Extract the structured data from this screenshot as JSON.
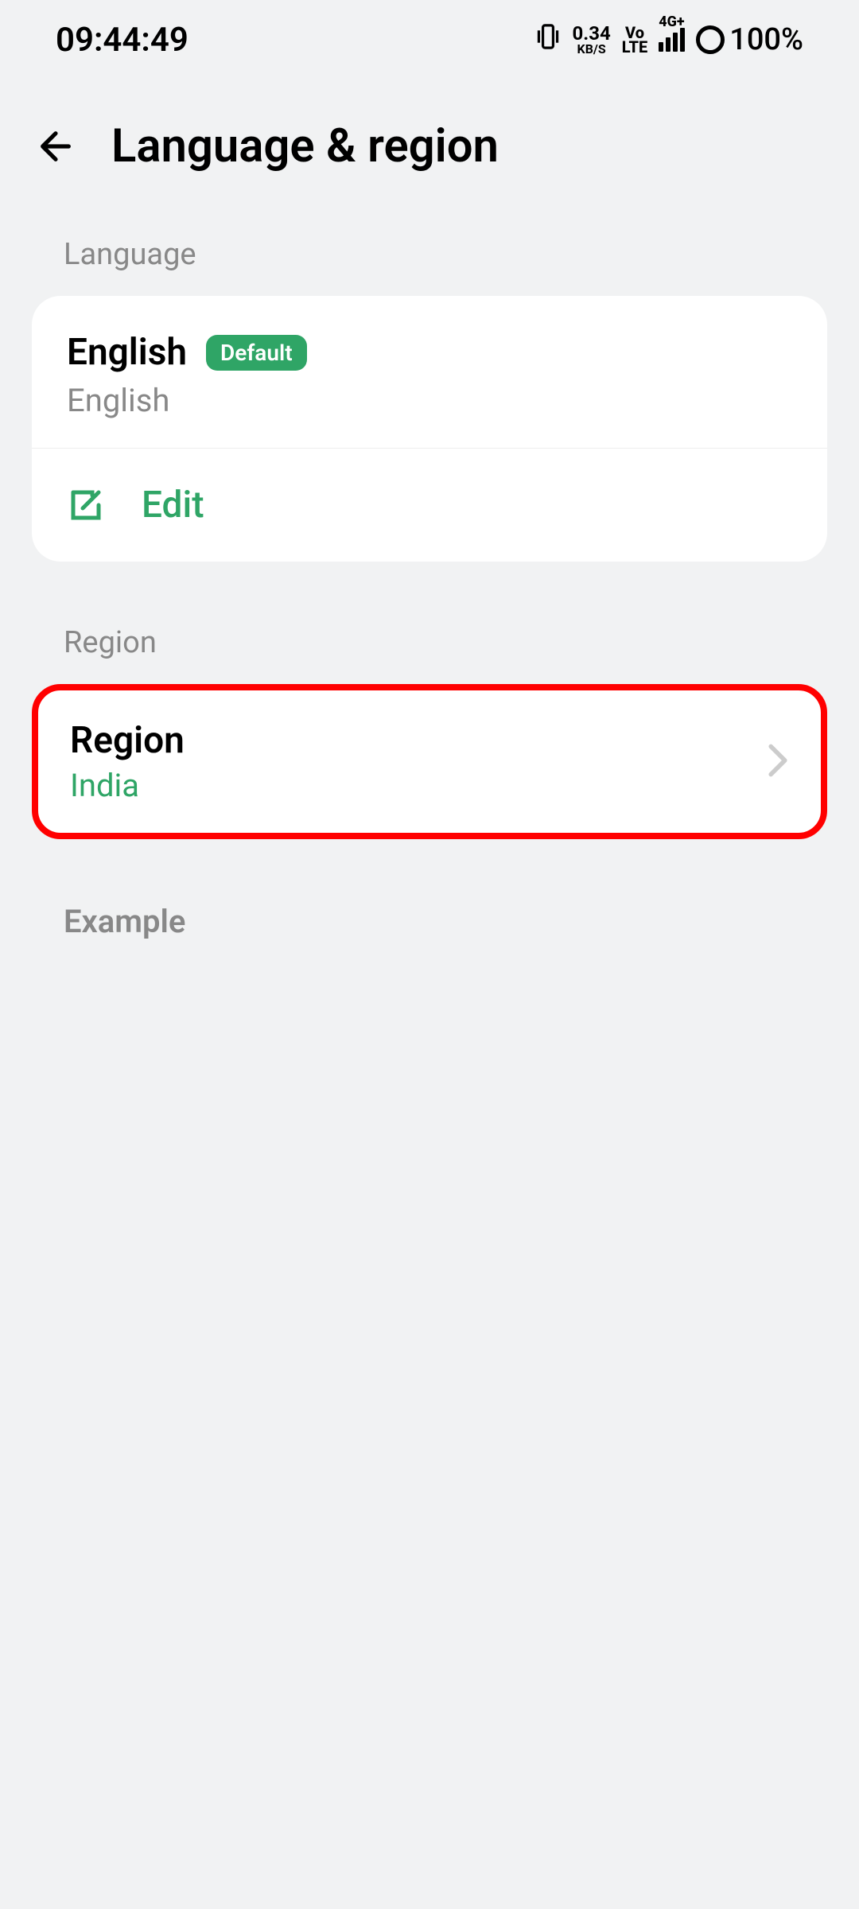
{
  "statusBar": {
    "time": "09:44:49",
    "dataRateNum": "0.34",
    "dataRateUnit": "KB/S",
    "volteTop": "Vo",
    "volteBottom": "LTE",
    "networkLabel": "4G+",
    "batteryPct": "100%"
  },
  "header": {
    "title": "Language & region"
  },
  "sections": {
    "languageLabel": "Language",
    "regionLabel": "Region",
    "exampleLabel": "Example"
  },
  "language": {
    "name": "English",
    "badge": "Default",
    "subtitle": "English",
    "editLabel": "Edit"
  },
  "region": {
    "title": "Region",
    "value": "India"
  }
}
